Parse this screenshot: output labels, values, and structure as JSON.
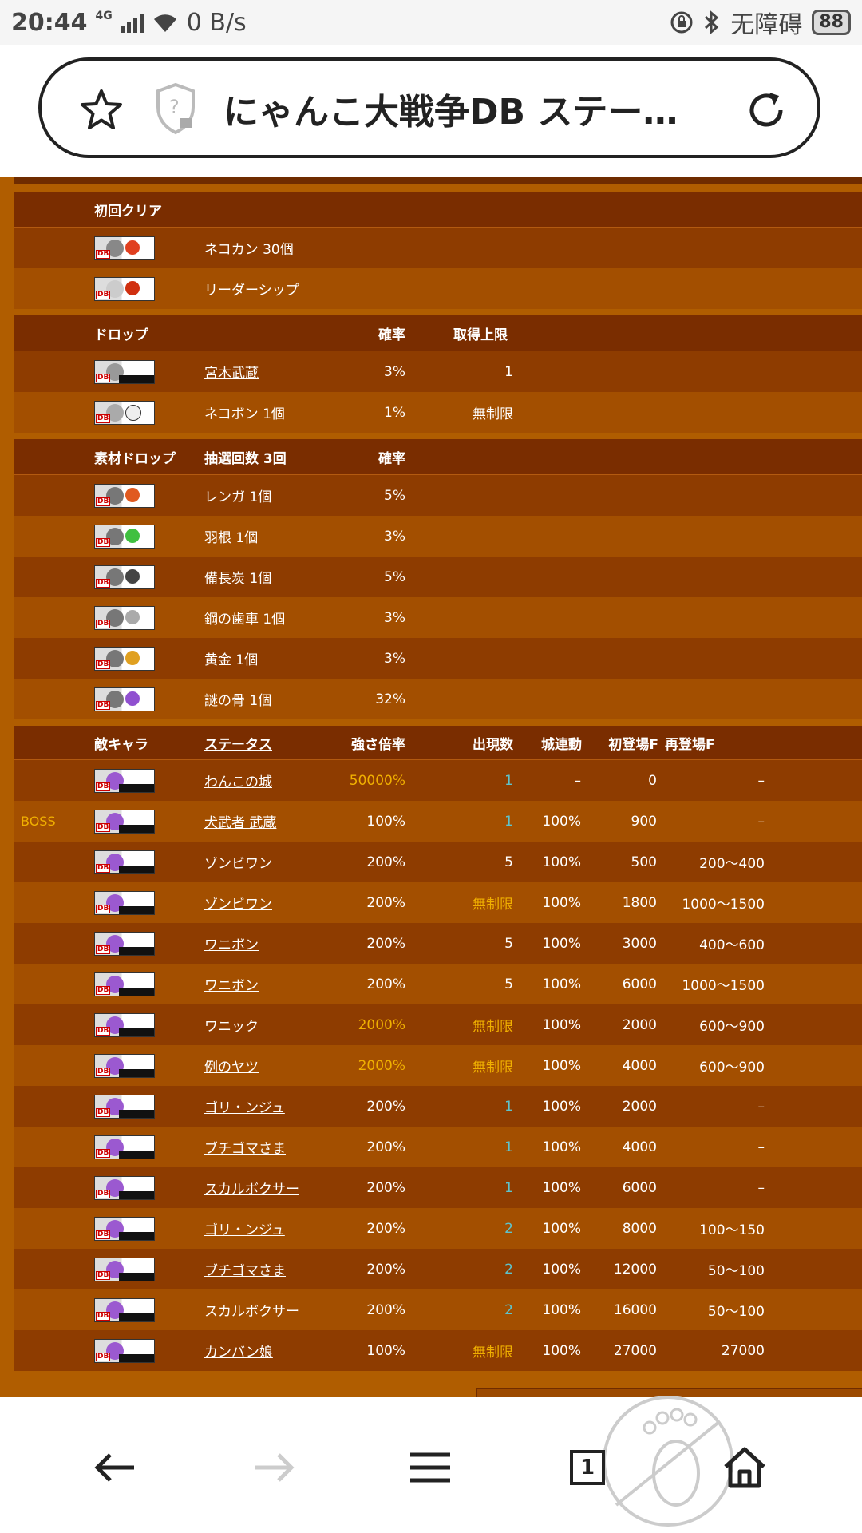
{
  "status": {
    "time": "20:44",
    "network": "4G",
    "speed": "0 B/s",
    "accessibility": "无障碍",
    "battery": "88"
  },
  "urlbar": {
    "title": "にゃんこ大戦争DB ステー…"
  },
  "first_clear": {
    "header": "初回クリア",
    "items": [
      {
        "name": "ネコカン 30個"
      },
      {
        "name": "リーダーシップ"
      }
    ]
  },
  "drop": {
    "header": "ドロップ",
    "rate_label": "確率",
    "cap_label": "取得上限",
    "items": [
      {
        "name": "宮木武蔵",
        "rate": "3%",
        "cap": "1"
      },
      {
        "name": "ネコボン 1個",
        "rate": "1%",
        "cap": "無制限"
      }
    ]
  },
  "material": {
    "header": "素材ドロップ",
    "draws": "抽選回数 3回",
    "rate_label": "確率",
    "items": [
      {
        "name": "レンガ 1個",
        "rate": "5%"
      },
      {
        "name": "羽根 1個",
        "rate": "3%"
      },
      {
        "name": "備長炭 1個",
        "rate": "5%"
      },
      {
        "name": "鋼の歯車 1個",
        "rate": "3%"
      },
      {
        "name": "黄金 1個",
        "rate": "3%"
      },
      {
        "name": "謎の骨 1個",
        "rate": "32%"
      }
    ]
  },
  "enemies": {
    "header": "敵キャラ",
    "status_label": "ステータス",
    "mag_label": "強さ倍率",
    "count_label": "出現数",
    "castle_label": "城連動",
    "first_label": "初登場F",
    "re_label": "再登場F",
    "rows": [
      {
        "boss": "",
        "name": "わんこの城",
        "mag": "50000%",
        "count": "1",
        "castle": "–",
        "first": "0",
        "re": "–"
      },
      {
        "boss": "BOSS",
        "name": "犬武者 武蔵",
        "mag": "100%",
        "count": "1",
        "castle": "100%",
        "first": "900",
        "re": "–"
      },
      {
        "boss": "",
        "name": "ゾンビワン",
        "mag": "200%",
        "count": "5",
        "castle": "100%",
        "first": "500",
        "re": "200～400"
      },
      {
        "boss": "",
        "name": "ゾンビワン",
        "mag": "200%",
        "count": "無制限",
        "castle": "100%",
        "first": "1800",
        "re": "1000～1500"
      },
      {
        "boss": "",
        "name": "ワニボン",
        "mag": "200%",
        "count": "5",
        "castle": "100%",
        "first": "3000",
        "re": "400～600"
      },
      {
        "boss": "",
        "name": "ワニボン",
        "mag": "200%",
        "count": "5",
        "castle": "100%",
        "first": "6000",
        "re": "1000～1500"
      },
      {
        "boss": "",
        "name": "ワニック",
        "mag": "2000%",
        "count": "無制限",
        "castle": "100%",
        "first": "2000",
        "re": "600～900"
      },
      {
        "boss": "",
        "name": "例のヤツ",
        "mag": "2000%",
        "count": "無制限",
        "castle": "100%",
        "first": "4000",
        "re": "600～900"
      },
      {
        "boss": "",
        "name": "ゴリ・ンジュ",
        "mag": "200%",
        "count": "1",
        "castle": "100%",
        "first": "2000",
        "re": "–"
      },
      {
        "boss": "",
        "name": "ブチゴマさま",
        "mag": "200%",
        "count": "1",
        "castle": "100%",
        "first": "4000",
        "re": "–"
      },
      {
        "boss": "",
        "name": "スカルボクサー",
        "mag": "200%",
        "count": "1",
        "castle": "100%",
        "first": "6000",
        "re": "–"
      },
      {
        "boss": "",
        "name": "ゴリ・ンジュ",
        "mag": "200%",
        "count": "2",
        "castle": "100%",
        "first": "8000",
        "re": "100～150"
      },
      {
        "boss": "",
        "name": "ブチゴマさま",
        "mag": "200%",
        "count": "2",
        "castle": "100%",
        "first": "12000",
        "re": "50～100"
      },
      {
        "boss": "",
        "name": "スカルボクサー",
        "mag": "200%",
        "count": "2",
        "castle": "100%",
        "first": "16000",
        "re": "50～100"
      },
      {
        "boss": "",
        "name": "カンバン娘",
        "mag": "100%",
        "count": "無制限",
        "castle": "100%",
        "first": "27000",
        "re": "27000"
      }
    ]
  },
  "bottomnav": {
    "tab_count": "1"
  },
  "colors": {
    "page_bg": "#b05d00",
    "header_bg": "#7a2d00",
    "row_dark": "#8e3c00",
    "row_light": "#a34f00",
    "gold": "#f0b000",
    "teal": "#5dc3cc"
  }
}
